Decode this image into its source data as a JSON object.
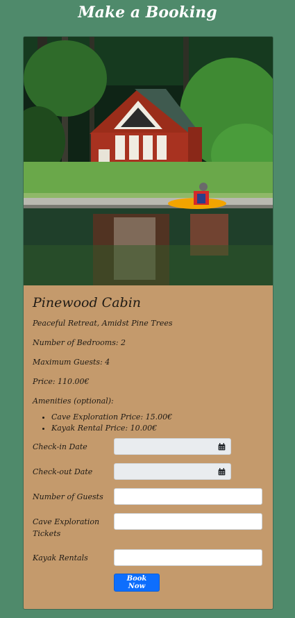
{
  "page": {
    "title": "Make a Booking"
  },
  "listing": {
    "name": "Pinewood Cabin",
    "tagline": "Peaceful Retreat, Amidst Pine Trees",
    "bedrooms": "Number of Bedrooms: 2",
    "max_guests": "Maximum Guests: 4",
    "price": "Price: 110.00€",
    "amenities_heading": "Amenities (optional):",
    "amenities": [
      "Cave Exploration Price: 15.00€",
      "Kayak Rental Price: 10.00€"
    ]
  },
  "form": {
    "checkin_label": "Check-in Date",
    "checkout_label": "Check-out Date",
    "guests_label": "Number of Guests",
    "cave_label": "Cave Exploration Tickets",
    "kayak_label": "Kayak Rentals",
    "submit_label": "Book Now"
  },
  "icons": {
    "calendar": "calendar-icon"
  },
  "colors": {
    "background": "#4f8a6b",
    "card": "#c49a6c",
    "button": "#0d6efd"
  }
}
